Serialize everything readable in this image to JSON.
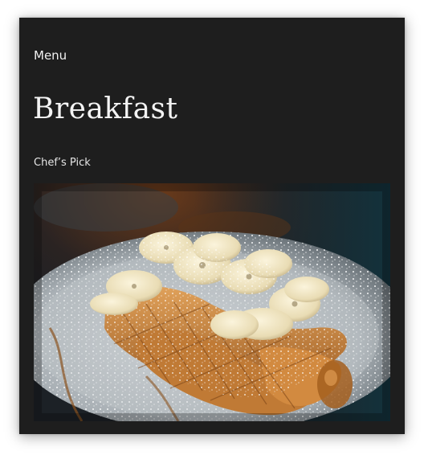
{
  "nav": {
    "menu_label": "Menu"
  },
  "page": {
    "title": "Breakfast",
    "subtitle": "Chef’s Pick"
  },
  "colors": {
    "card_background": "#1e1e1e",
    "text": "#f2f2f2"
  }
}
